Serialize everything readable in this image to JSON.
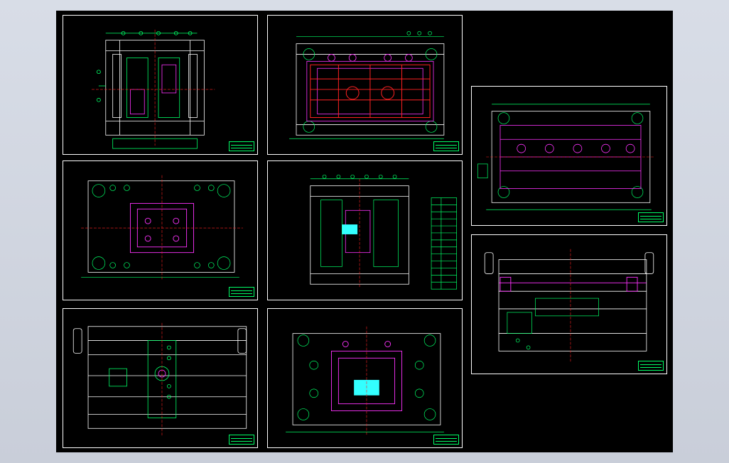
{
  "viewer": {
    "title": "",
    "background": "#000000",
    "frame_color": "#ffffff",
    "colors": {
      "green": "#00ff66",
      "magenta": "#ff33ff",
      "red": "#ff2222",
      "cyan": "#33ffff",
      "yellow": "#ffff33",
      "white": "#ffffff"
    }
  },
  "sheets": [
    {
      "id": "sheet-1",
      "kind": "section-view"
    },
    {
      "id": "sheet-2",
      "kind": "plan-view-dense"
    },
    {
      "id": "sheet-3",
      "kind": "plan-view-cavity"
    },
    {
      "id": "sheet-4",
      "kind": "section-with-bom-table"
    },
    {
      "id": "sheet-5",
      "kind": "elevation-view"
    },
    {
      "id": "sheet-6",
      "kind": "plan-view-cyan-insert"
    },
    {
      "id": "sheet-7",
      "kind": "plan-view-wide"
    },
    {
      "id": "sheet-8",
      "kind": "section-view-wide"
    }
  ]
}
